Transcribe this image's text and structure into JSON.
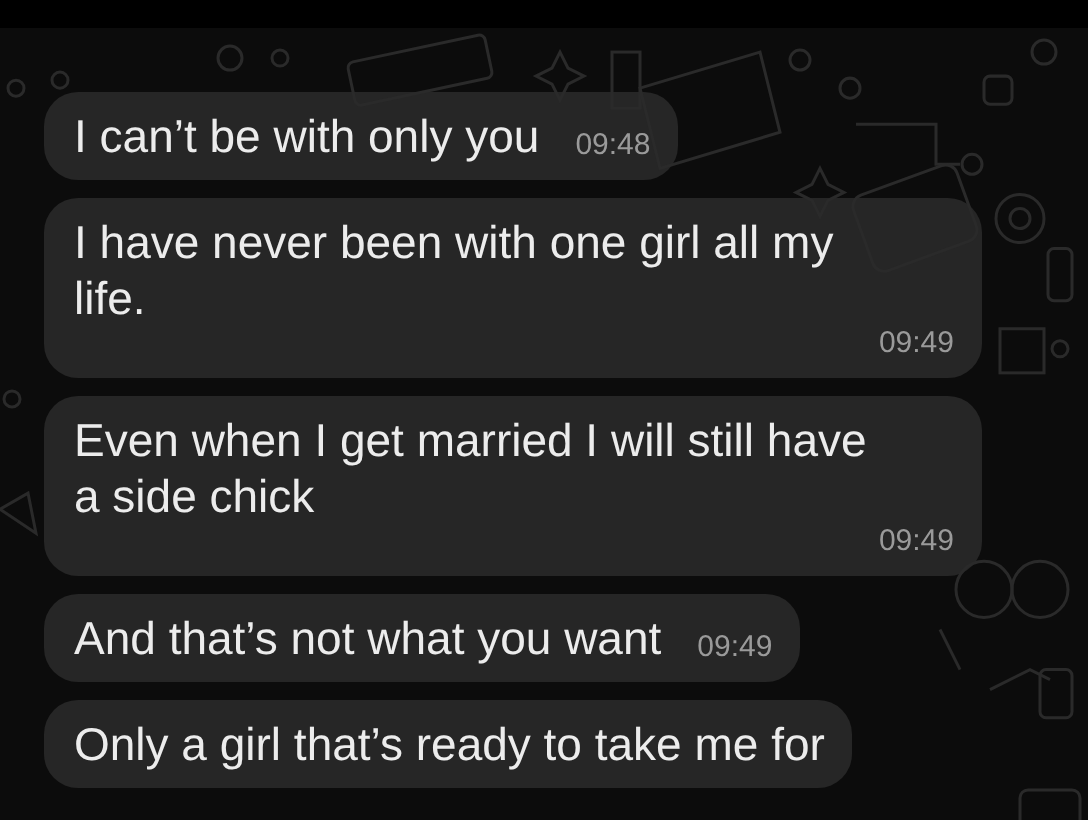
{
  "messages": [
    {
      "text": "I can’t be with only you",
      "time": "09:48"
    },
    {
      "text": "I have never been with one girl all my life.",
      "time": "09:49"
    },
    {
      "text": "Even when I get married I will still have a side chick",
      "time": "09:49"
    },
    {
      "text": "And that’s not what you want",
      "time": "09:49"
    },
    {
      "text": "Only a girl that’s ready to take me for"
    }
  ]
}
